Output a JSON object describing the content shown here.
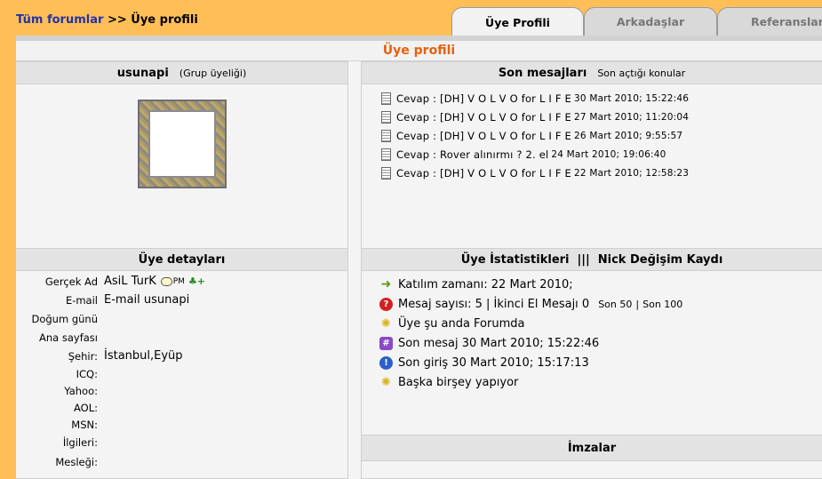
{
  "breadcrumb": {
    "root": "Tüm forumlar",
    "separator": ">>",
    "current": "Üye profili"
  },
  "tabs": [
    {
      "label": "Üye Profili",
      "active": true
    },
    {
      "label": "Arkadaşlar",
      "active": false
    },
    {
      "label": "Referanslar",
      "active": false
    }
  ],
  "panel": {
    "title": "Üye profili"
  },
  "profile": {
    "username": "usunapi",
    "group": "(Grup üyeliği)"
  },
  "messages": {
    "header": "Son mesajları",
    "header_link": "Son açtığı konular",
    "items": [
      {
        "text": "Cevap : [DH] V O L V O for L I F E",
        "date": "30 Mart 2010; 15:22:46"
      },
      {
        "text": "Cevap : [DH] V O L V O for L I F E",
        "date": "27 Mart 2010; 11:20:04"
      },
      {
        "text": "Cevap : [DH] V O L V O for L I F E",
        "date": "26 Mart 2010; 9:55:57"
      },
      {
        "text": "Cevap : Rover alınırmı ? 2. el",
        "date": "24 Mart 2010; 19:06:40"
      },
      {
        "text": "Cevap : [DH] V O L V O for L I F E",
        "date": "22 Mart 2010; 12:58:23"
      }
    ]
  },
  "details": {
    "header": "Üye detayları",
    "rows": [
      {
        "label": "Gerçek Ad",
        "value": "AsiL TurK"
      },
      {
        "label": "E-mail",
        "value": "E-mail usunapi"
      },
      {
        "label": "Doğum günü",
        "value": ""
      },
      {
        "label": "Ana sayfası",
        "value": ""
      },
      {
        "label": "Şehir:",
        "value": "İstanbul,Eyüp"
      },
      {
        "label": "ICQ:",
        "value": ""
      },
      {
        "label": "Yahoo:",
        "value": ""
      },
      {
        "label": "AOL:",
        "value": ""
      },
      {
        "label": "MSN:",
        "value": ""
      },
      {
        "label": "İlgileri:",
        "value": ""
      },
      {
        "label": "Mesleği:",
        "value": ""
      }
    ],
    "pm_label": "PM"
  },
  "stats": {
    "header_left": "Üye İstatistikleri",
    "header_sep": "|||",
    "header_right": "Nick Değişim Kaydı",
    "joined": "Katılım zamanı: 22 Mart 2010;",
    "message_count": "Mesaj sayısı: 5 | İkinci El Mesajı 0",
    "last50": "Son 50",
    "last_sep": "|",
    "last100": "Son 100",
    "online": "Üye şu anda Forumda",
    "last_message": "Son mesaj 30 Mart 2010; 15:22:46",
    "last_login": "Son giriş 30 Mart 2010; 15:17:13",
    "activity": "Başka birşey yapıyor"
  },
  "signatures": {
    "header": "İmzalar"
  },
  "colors": {
    "background": "#FFBF56",
    "title_accent": "#E8600A",
    "link": "#2233AA"
  }
}
